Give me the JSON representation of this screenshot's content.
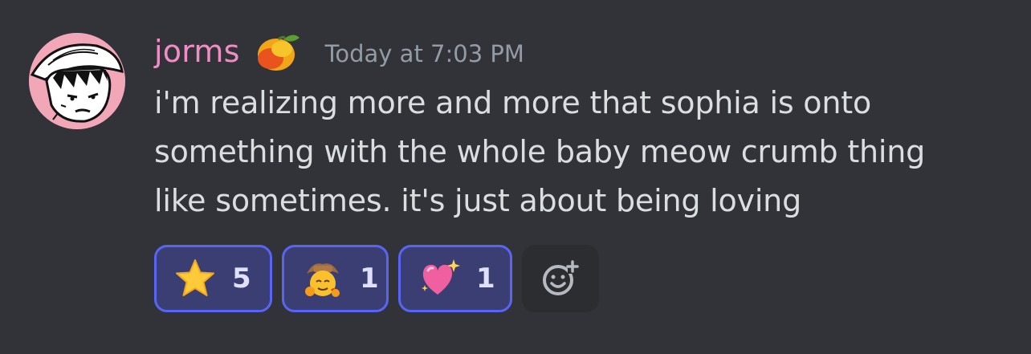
{
  "message": {
    "author": "jorms",
    "timestamp": "Today at 7:03 PM",
    "text": "i'm realizing more and more that sophia is onto\nsomething with the whole baby meow crumb thing\nlike sometimes. it's just about being loving"
  },
  "reactions": [
    {
      "emoji": "star-emoji",
      "count": "5"
    },
    {
      "emoji": "cowboy-hugging-emoji",
      "count": "1"
    },
    {
      "emoji": "sparkling-heart-emoji",
      "count": "1"
    }
  ],
  "colors": {
    "background": "#313338",
    "username": "#ee8ec4",
    "timestamp": "#949ba4",
    "text": "#dbdee1",
    "reaction_bg": "#3b3e72",
    "reaction_border": "#5865f2"
  }
}
